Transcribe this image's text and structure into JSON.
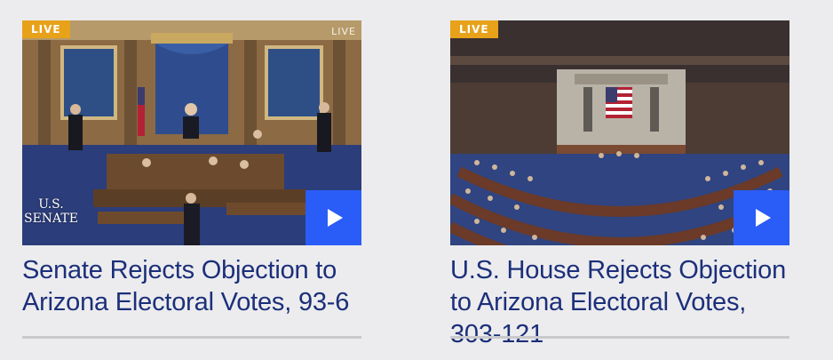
{
  "videos": [
    {
      "badge": "LIVE",
      "bug": "LIVE",
      "network_logo_line1": "U.S.",
      "network_logo_line2": "SENATE",
      "title": "Senate Rejects Objection to Arizona Electoral Votes, 93-6",
      "play_icon": "play-icon"
    },
    {
      "badge": "LIVE",
      "title": "U.S. House Rejects Objection to Arizona Electoral Votes, 303-121",
      "play_icon": "play-icon"
    }
  ],
  "colors": {
    "live_badge": "#e7a21a",
    "play_button": "#2a5cf7",
    "headline": "#1c2f7a",
    "background": "#ececee"
  }
}
